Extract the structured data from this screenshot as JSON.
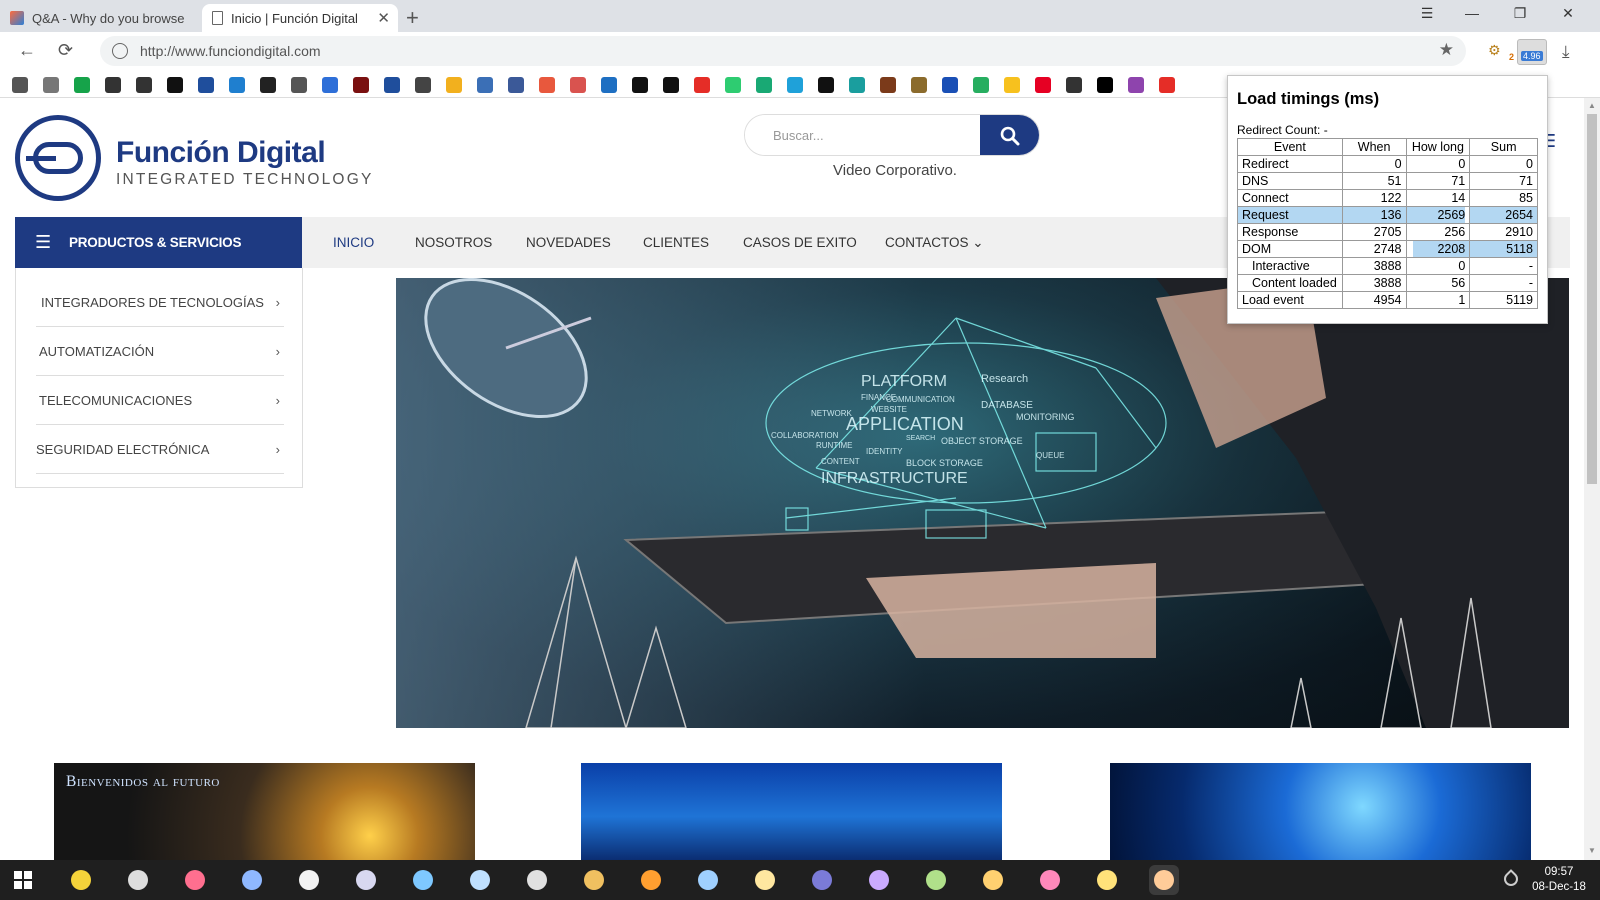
{
  "browser": {
    "tabs": [
      {
        "title": "Q&A - Why do you browse"
      },
      {
        "title": "Inicio | Función Digital",
        "close": "✕"
      }
    ],
    "new_tab_glyph": "+",
    "window_controls": [
      "☰",
      "—",
      "❐",
      "✕"
    ],
    "nav": {
      "back": "←",
      "reload": "⟳"
    },
    "url": "http://www.funciondigital.com",
    "star_glyph": "★",
    "extension_badges": {
      "ext1": "2",
      "timer": "4.96"
    },
    "download_glyph": "⤓",
    "bookmark_colors": [
      "#555555",
      "#777777",
      "#16a34a",
      "#333333",
      "#333333",
      "#111111",
      "#1f4e9c",
      "#1f7fcf",
      "#222222",
      "#555555",
      "#2e6fd8",
      "#7a1010",
      "#1f4e9c",
      "#444444",
      "#f2b01e",
      "#3b6fb6",
      "#3b5998",
      "#e8583d",
      "#d9534f",
      "#1e6fc2",
      "#111111",
      "#111111",
      "#e52d27",
      "#2ecc71",
      "#19a974",
      "#1fa1d9",
      "#111111",
      "#1a9e9e",
      "#7b3a1a",
      "#8b6b2c",
      "#1a4fb5",
      "#27ae60",
      "#f7c11e",
      "#e60023",
      "#333333",
      "#000000",
      "#8e44ad",
      "#e52d27"
    ]
  },
  "site": {
    "logo": {
      "name": "Función Digital",
      "tagline": "INTEGRATED TECHNOLOGY"
    },
    "search": {
      "placeholder": "Buscar..."
    },
    "header_link": "Video Corporativo.",
    "menu_glyph": "☰",
    "products_button": "PRODUCTOS & SERVICIOS",
    "nav": [
      {
        "label": "INICIO",
        "active": true
      },
      {
        "label": "NOSOTROS"
      },
      {
        "label": "NOVEDADES"
      },
      {
        "label": "CLIENTES"
      },
      {
        "label": "CASOS DE EXITO"
      },
      {
        "label": "CONTACTOS ⌄"
      }
    ],
    "side_menu": [
      {
        "label": "INTEGRADORES DE TECNOLOGÍAS"
      },
      {
        "label": "AUTOMATIZACIÓN"
      },
      {
        "label": "TELECOMUNICACIONES"
      },
      {
        "label": "SEGURIDAD ELECTRÓNICA"
      }
    ],
    "chevron_glyph": "›",
    "hero_words": [
      "PLATFORM",
      "Research",
      "APPLICATION",
      "INFRASTRUCTURE",
      "COMMUNICATION",
      "DATABASE",
      "FINANCE",
      "NETWORK",
      "COLLABORATION",
      "CONTENT",
      "RUNTIME",
      "IDENTITY",
      "MONITORING",
      "OBJECT STORAGE",
      "BLOCK STORAGE",
      "QUEUE",
      "WEBSITE",
      "SEARCH"
    ],
    "thumb1_text": "Bienvenidos al futuro"
  },
  "timings": {
    "title": "Load timings (ms)",
    "redirect_count": "Redirect Count: -",
    "columns": [
      "Event",
      "When",
      "How long",
      "Sum"
    ],
    "rows": [
      {
        "event": "Redirect",
        "when": "0",
        "how_long": "0",
        "sum": "0",
        "indent": false,
        "highlight": ""
      },
      {
        "event": "DNS",
        "when": "51",
        "how_long": "71",
        "sum": "71",
        "indent": false,
        "highlight": ""
      },
      {
        "event": "Connect",
        "when": "122",
        "how_long": "14",
        "sum": "85",
        "indent": false,
        "highlight": ""
      },
      {
        "event": "Request",
        "when": "136",
        "how_long": "2569",
        "sum": "2654",
        "indent": false,
        "highlight": "full"
      },
      {
        "event": "Response",
        "when": "2705",
        "how_long": "256",
        "sum": "2910",
        "indent": false,
        "highlight": ""
      },
      {
        "event": "DOM",
        "when": "2748",
        "how_long": "2208",
        "sum": "5118",
        "indent": false,
        "highlight": "partial"
      },
      {
        "event": "Interactive",
        "when": "3888",
        "how_long": "0",
        "sum": "-",
        "indent": true,
        "highlight": ""
      },
      {
        "event": "Content loaded",
        "when": "3888",
        "how_long": "56",
        "sum": "-",
        "indent": true,
        "highlight": ""
      },
      {
        "event": "Load event",
        "when": "4954",
        "how_long": "1",
        "sum": "5119",
        "indent": false,
        "highlight": ""
      }
    ]
  },
  "taskbar": {
    "time": "09:57",
    "date": "08-Dec-18",
    "app_colors": [
      "#f5d33a",
      "#dddddd",
      "#ff6f8f",
      "#8fb8ff",
      "#f2f2f2",
      "#d8d8f0",
      "#7ec8ff",
      "#bfe0ff",
      "#e0e0e0",
      "#f0c060",
      "#ff9f30",
      "#9fd0ff",
      "#ffe7a0",
      "#7b7bd8",
      "#caaaff",
      "#b0e08a",
      "#ffd070",
      "#ff88bb",
      "#ffe27a",
      "#ffcc99"
    ]
  },
  "colors": {
    "brand": "#1e3a82",
    "timing_highlight": "#b3d7f2"
  }
}
